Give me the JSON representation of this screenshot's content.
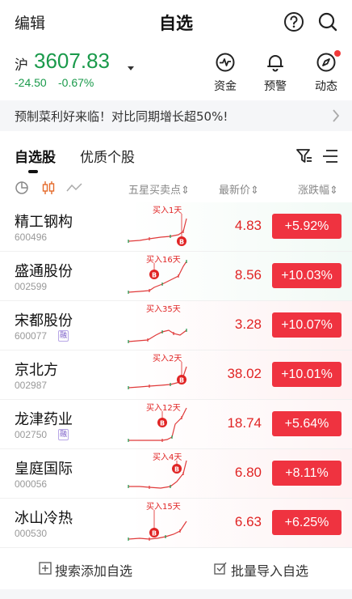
{
  "header": {
    "edit_label": "编辑",
    "title": "自选"
  },
  "index": {
    "name": "沪",
    "value": "3607.83",
    "change": "-24.50",
    "change_pct": "-0.67%"
  },
  "quick_actions": [
    {
      "label": "资金",
      "icon": "pulse-icon"
    },
    {
      "label": "预警",
      "icon": "bell-icon"
    },
    {
      "label": "动态",
      "icon": "compass-icon"
    }
  ],
  "banner": {
    "text": "预制菜利好来临！对比同期增长超50%!"
  },
  "tabs": {
    "active": "自选股",
    "second": "优质个股"
  },
  "columns": {
    "signal": "五星买卖点",
    "price": "最新价",
    "change": "涨跌幅"
  },
  "stocks": [
    {
      "name": "精工钢构",
      "code": "600496",
      "rong": "",
      "signal": "买入1天",
      "price": "4.83",
      "change": "+5.92%"
    },
    {
      "name": "盛通股份",
      "code": "002599",
      "rong": "",
      "signal": "买入16天",
      "price": "8.56",
      "change": "+10.03%"
    },
    {
      "name": "宋都股份",
      "code": "600077",
      "rong": "融",
      "signal": "买入35天",
      "price": "3.28",
      "change": "+10.07%"
    },
    {
      "name": "京北方",
      "code": "002987",
      "rong": "",
      "signal": "买入2天",
      "price": "38.02",
      "change": "+10.01%"
    },
    {
      "name": "龙津药业",
      "code": "002750",
      "rong": "融",
      "signal": "买入12天",
      "price": "18.74",
      "change": "+5.64%"
    },
    {
      "name": "皇庭国际",
      "code": "000056",
      "rong": "",
      "signal": "买入4天",
      "price": "6.80",
      "change": "+8.11%"
    },
    {
      "name": "冰山冷热",
      "code": "000530",
      "rong": "",
      "signal": "买入15天",
      "price": "6.63",
      "change": "+6.25%"
    }
  ],
  "footer": {
    "search_add": "搜索添加自选",
    "batch_import": "批量导入自选"
  },
  "colors": {
    "up": "#ef3340",
    "down": "#1a9a4b"
  }
}
